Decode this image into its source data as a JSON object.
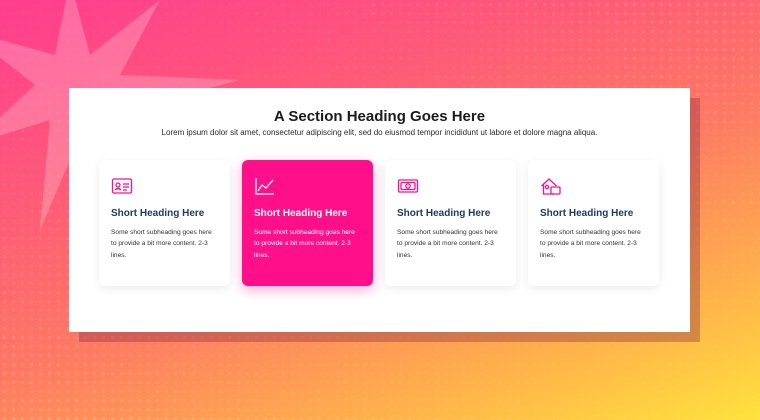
{
  "section": {
    "heading": "A Section Heading Goes Here",
    "subheading": "Lorem ipsum dolor sit amet, consectetur adipiscing elit, sed do eiusmod tempor incididunt ut labore et dolore magna aliqua."
  },
  "cards": [
    {
      "icon": "id-card-icon",
      "title": "Short Heading Here",
      "text": "Some short subheading goes here to provide a bit more content. 2-3 lines.",
      "active": false
    },
    {
      "icon": "line-chart-icon",
      "title": "Short Heading Here",
      "text": "Some short subheading goes here to provide a bit more content. 2-3 lines.",
      "active": true
    },
    {
      "icon": "cash-icon",
      "title": "Short Heading Here",
      "text": "Some short subheading goes here to provide a bit more content. 2-3 lines.",
      "active": false
    },
    {
      "icon": "house-icon",
      "title": "Short Heading Here",
      "text": "Some short subheading goes here to provide a bit more content. 2-3 lines.",
      "active": false
    }
  ],
  "colors": {
    "accent": "#ff0f8a",
    "card_title": "#1f3a66",
    "background_start": "#ff3d8f",
    "background_end": "#ffe23d"
  }
}
